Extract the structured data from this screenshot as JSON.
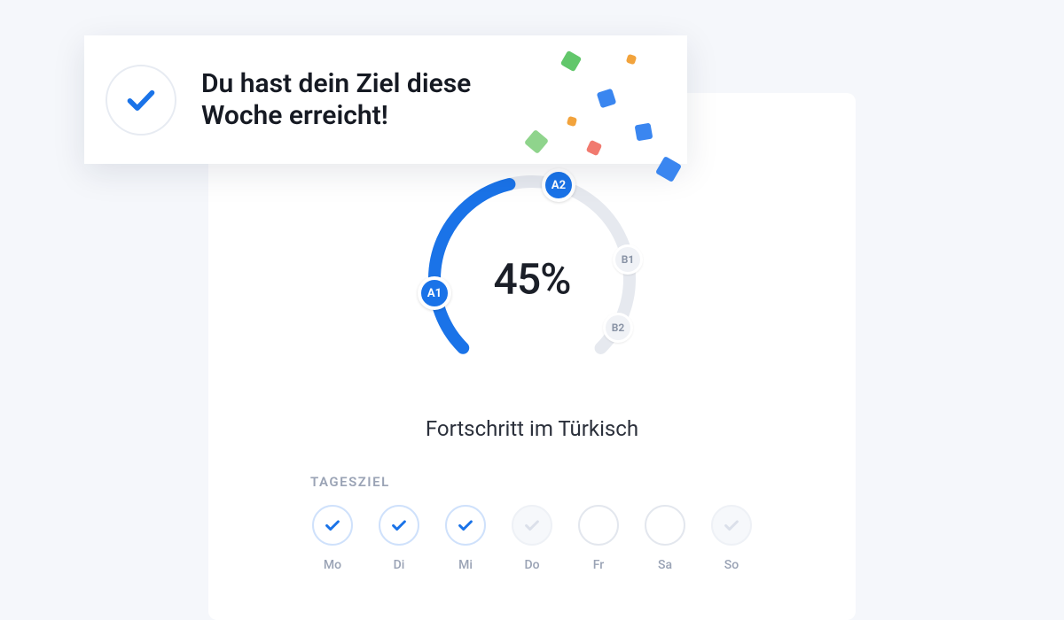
{
  "toast": {
    "message": "Du hast dein Ziel diese Woche erreicht!"
  },
  "gauge": {
    "percent_label": "45%",
    "percent_value": 45,
    "levels": [
      {
        "code": "A1",
        "achieved": true
      },
      {
        "code": "A2",
        "achieved": true
      },
      {
        "code": "B1",
        "achieved": false
      },
      {
        "code": "B2",
        "achieved": false
      }
    ]
  },
  "progress_label": "Fortschritt im Türkisch",
  "daily": {
    "title": "TAGESZIEL",
    "days": [
      {
        "label": "Mo",
        "state": "done"
      },
      {
        "label": "Di",
        "state": "done"
      },
      {
        "label": "Mi",
        "state": "done"
      },
      {
        "label": "Do",
        "state": "ghost"
      },
      {
        "label": "Fr",
        "state": "empty"
      },
      {
        "label": "Sa",
        "state": "empty"
      },
      {
        "label": "So",
        "state": "ghost"
      }
    ]
  },
  "colors": {
    "primary": "#1a73e8",
    "confetti_green": "#62c76b",
    "confetti_orange": "#f2a33c",
    "confetti_red": "#f17a6f",
    "confetti_blue": "#3a86f0"
  }
}
